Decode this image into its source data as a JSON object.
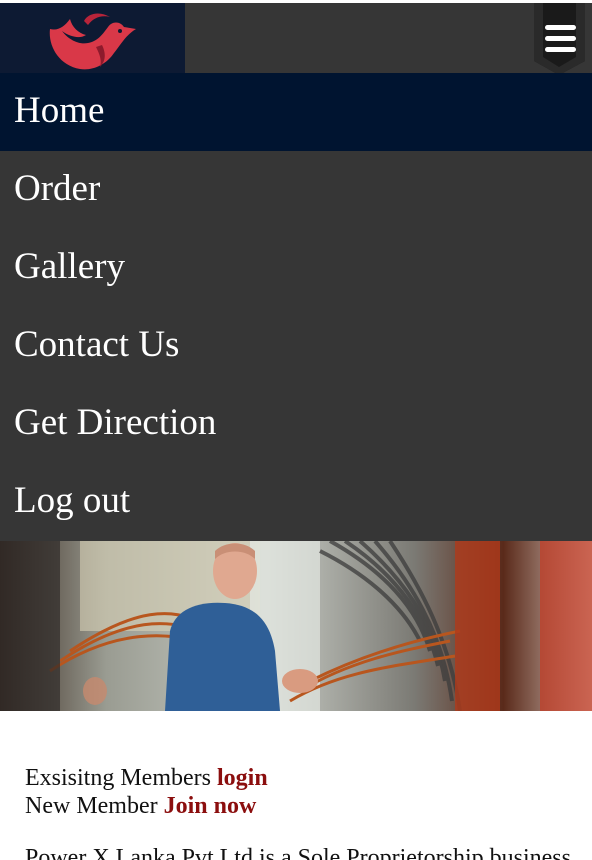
{
  "nav": {
    "items": [
      {
        "label": "Home",
        "active": true
      },
      {
        "label": "Order",
        "active": false
      },
      {
        "label": "Gallery",
        "active": false
      },
      {
        "label": "Contact Us",
        "active": false
      },
      {
        "label": "Get Direction",
        "active": false
      },
      {
        "label": "Log out",
        "active": false
      }
    ]
  },
  "header": {
    "logo_icon": "bird-logo-icon",
    "menu_icon": "hamburger-menu-icon"
  },
  "members": {
    "existing_text": "Exsisitng Members ",
    "login_label": "login",
    "new_text": "New Member ",
    "join_label": "Join now"
  },
  "about": {
    "text": "Power X Lanka Pvt Ltd is a Sole Proprietorship business"
  },
  "colors": {
    "nav_bg": "#363636",
    "nav_active_bg": "#001430",
    "logo_bg": "#0d1a33",
    "logo_red": "#d93848",
    "link_color": "#8b0e0e"
  }
}
